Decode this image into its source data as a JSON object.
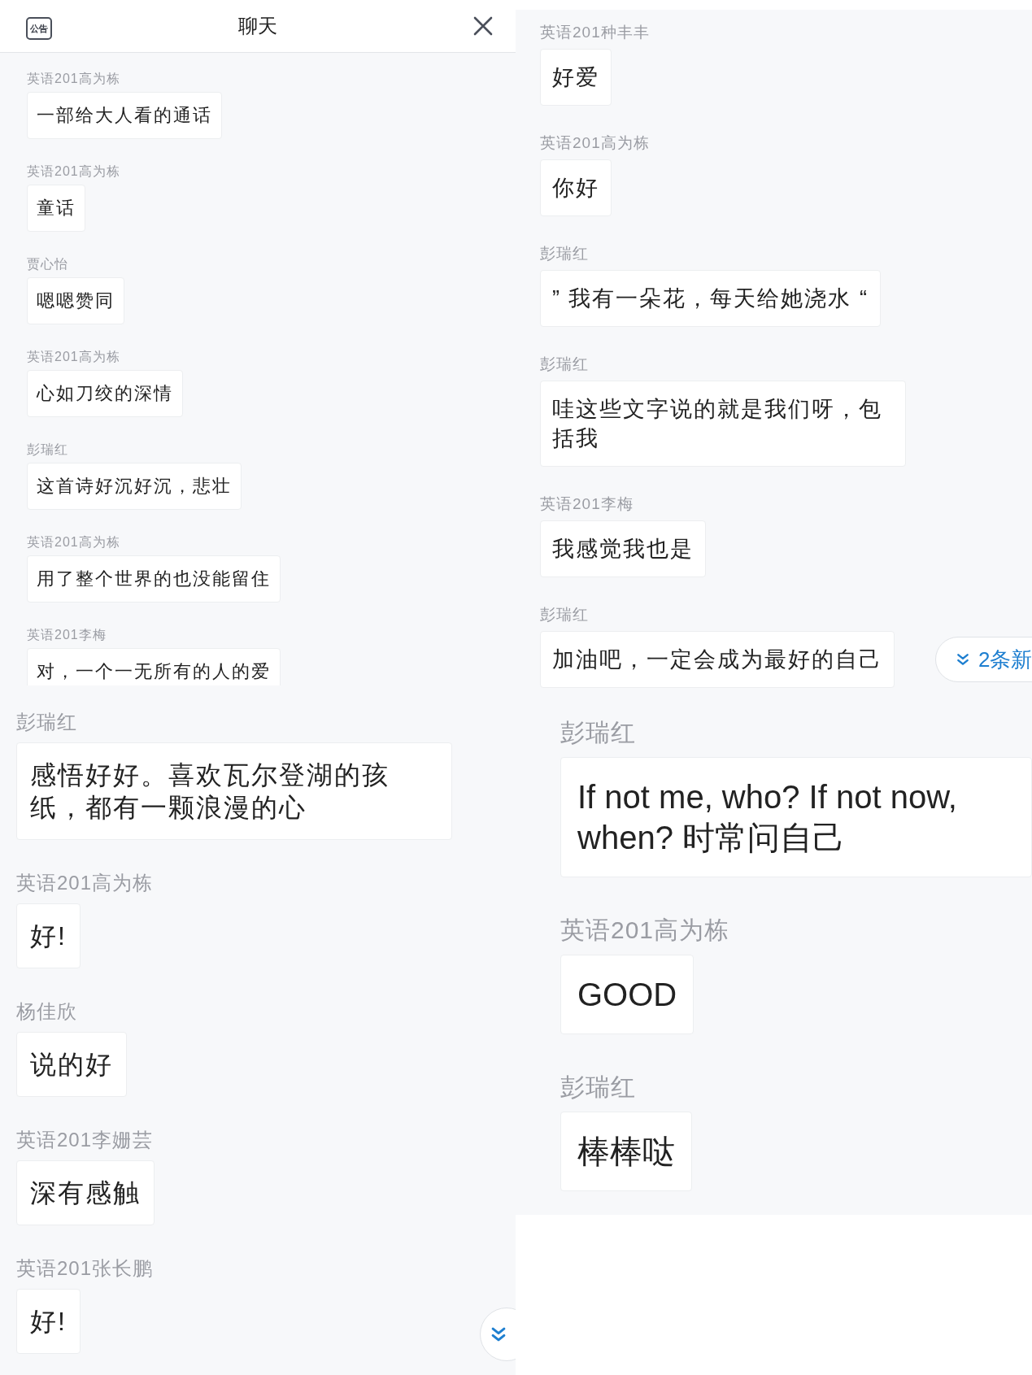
{
  "panels": [
    {
      "header": {
        "notice_label": "公告",
        "title": "聊天"
      },
      "messages": [
        {
          "sender": "英语201高为栋",
          "text": "一部给大人看的通话"
        },
        {
          "sender": "英语201高为栋",
          "text": "童话"
        },
        {
          "sender": "贾心怡",
          "text": "嗯嗯赞同"
        },
        {
          "sender": "英语201高为栋",
          "text": "心如刀绞的深情"
        },
        {
          "sender": "彭瑞红",
          "text": "这首诗好沉好沉，悲壮"
        },
        {
          "sender": "英语201高为栋",
          "text": "用了整个世界的也没能留住"
        },
        {
          "sender": "英语201李梅",
          "text": "对，一个一无所有的人的爱"
        }
      ]
    },
    {
      "messages": [
        {
          "sender": "彭瑞红",
          "text": "感悟好好。喜欢瓦尔登湖的孩纸，都有一颗浪漫的心"
        },
        {
          "sender": "英语201高为栋",
          "text": "好!"
        },
        {
          "sender": "杨佳欣",
          "text": "说的好"
        },
        {
          "sender": "英语201李姗芸",
          "text": "深有感触"
        },
        {
          "sender": "英语201张长鹏",
          "text": "好!"
        }
      ],
      "scroll_down": true
    },
    {
      "messages": [
        {
          "sender": "英语201种丰丰",
          "text": "好爱"
        },
        {
          "sender": "英语201高为栋",
          "text": "你好"
        },
        {
          "sender": "彭瑞红",
          "text": "” 我有一朵花，每天给她浇水 “"
        },
        {
          "sender": "彭瑞红",
          "text": "哇这些文字说的就是我们呀，包括我"
        },
        {
          "sender": "英语201李梅",
          "text": "我感觉我也是"
        },
        {
          "sender": "彭瑞红",
          "text": "加油吧，一定会成为最好的自己"
        }
      ],
      "new_messages": {
        "label": "2条新"
      }
    },
    {
      "messages": [
        {
          "sender": "彭瑞红",
          "text": "If not me, who? If not now, when? 时常问自己"
        },
        {
          "sender": "英语201高为栋",
          "text": "GOOD"
        },
        {
          "sender": "彭瑞红",
          "text": "棒棒哒"
        }
      ]
    }
  ]
}
